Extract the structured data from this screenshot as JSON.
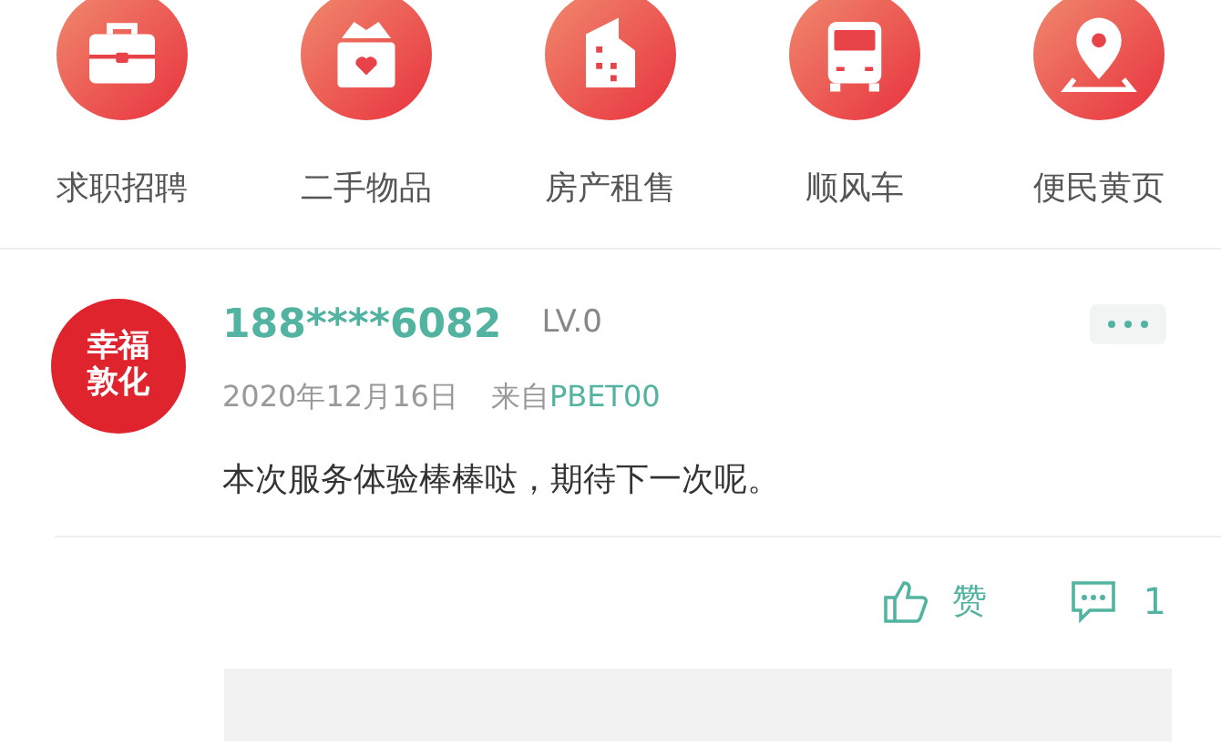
{
  "categories": [
    {
      "kind": "briefcase",
      "label": "求职招聘"
    },
    {
      "kind": "box",
      "label": "二手物品"
    },
    {
      "kind": "building",
      "label": "房产租售"
    },
    {
      "kind": "car",
      "label": "顺风车"
    },
    {
      "kind": "pin",
      "label": "便民黄页"
    }
  ],
  "comment": {
    "avatar_text": "幸福敦化",
    "user": "188****6082",
    "level": "LV.0",
    "date": "2020年12月16日",
    "source_prefix": "来自",
    "source": "PBET00",
    "text": "本次服务体验棒棒哒，期待下一次呢。",
    "like_label": "赞",
    "reply_count": "1"
  }
}
